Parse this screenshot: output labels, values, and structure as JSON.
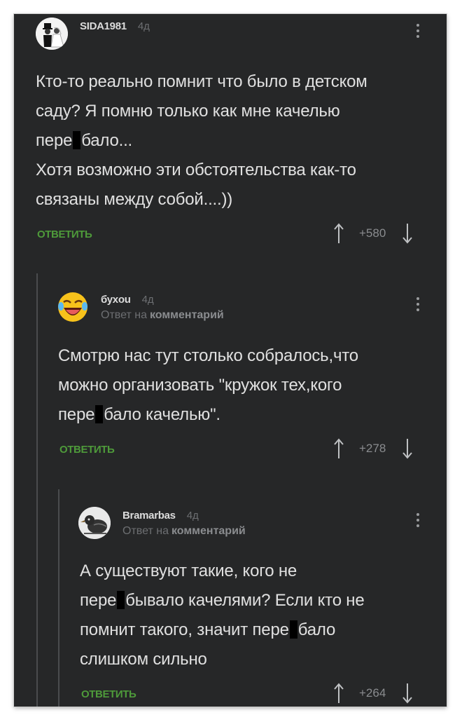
{
  "comments": [
    {
      "username": "SIDA1981",
      "time": "4д",
      "reply_prefix": "",
      "reply_target": "",
      "lines": [
        [
          "Кто-то реально помнит что было в детском"
        ],
        [
          "саду? Я помню только как мне качелью"
        ],
        [
          "пере",
          "бало..."
        ],
        [
          "Хотя возможно эти обстоятельства как-то"
        ],
        [
          "связаны между собой....))"
        ]
      ],
      "reply_label": "ОТВЕТИТЬ",
      "score": "+580",
      "avatar": "bride-groom-avatar"
    },
    {
      "username": "буxou",
      "time": "4д",
      "reply_prefix": "Ответ на",
      "reply_target": "комментарий",
      "lines": [
        [
          "Смотрю нас тут столько собралось,что"
        ],
        [
          "можно организовать \"кружок тех,кого"
        ],
        [
          "пере",
          "бало качелью\"."
        ]
      ],
      "reply_label": "ОТВЕТИТЬ",
      "score": "+278",
      "avatar": "laughing-emoji-avatar"
    },
    {
      "username": "Bramarbas",
      "time": "4д",
      "reply_prefix": "Ответ на",
      "reply_target": "комментарий",
      "lines": [
        [
          "А существуют такие, кого не"
        ],
        [
          "пере",
          "бывало качелями? Если кто не"
        ],
        [
          "помнит такого, значит пере",
          "бало"
        ],
        [
          "слишком сильно"
        ]
      ],
      "reply_label": "ОТВЕТИТЬ",
      "score": "+264",
      "avatar": "bird-avatar"
    }
  ],
  "colors": {
    "background": "#262728",
    "text": "#e0e0e0",
    "muted": "#6d6f72",
    "reply": "#4e9a3a"
  }
}
